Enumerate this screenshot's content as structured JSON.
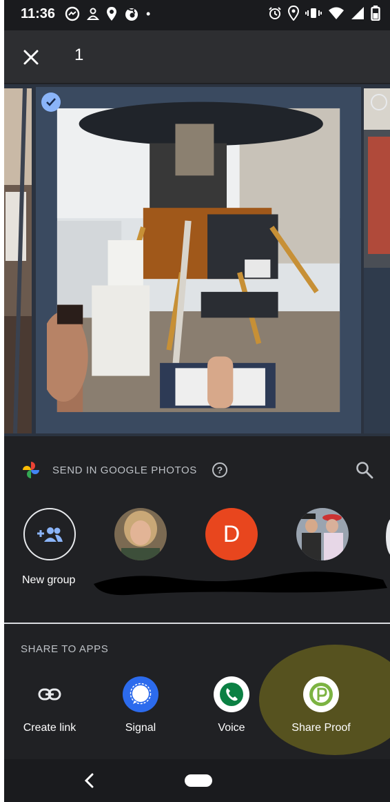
{
  "status_bar": {
    "time": "11:36",
    "left_icons": [
      "messenger-icon",
      "person-icon",
      "location-icon",
      "firefox-icon",
      "dot-icon"
    ],
    "right_icons": [
      "alarm-icon",
      "location-icon",
      "vibrate-icon",
      "wifi-icon",
      "signal-icon",
      "battery-icon"
    ]
  },
  "top_bar": {
    "close_icon": "close-icon",
    "selected_count": "1"
  },
  "photos": {
    "main_selected": true,
    "main_subject": "Lunar Module exhibit"
  },
  "send_section": {
    "title": "SEND IN GOOGLE PHOTOS",
    "help_icon": "help-icon",
    "search_icon": "search-icon",
    "new_group_label": "New group",
    "letter_contact": "D",
    "accent_color": "#e8461e"
  },
  "apps_section": {
    "title": "SHARE TO APPS",
    "apps": [
      {
        "label": "Create link",
        "icon": "link-icon"
      },
      {
        "label": "Signal",
        "icon": "signal-app-icon"
      },
      {
        "label": "Voice",
        "icon": "voice-app-icon"
      },
      {
        "label": "Share Proof",
        "icon": "share-proof-icon"
      }
    ]
  },
  "nav_bar": {
    "back_icon": "back-icon",
    "home_icon": "home-pill-icon"
  }
}
